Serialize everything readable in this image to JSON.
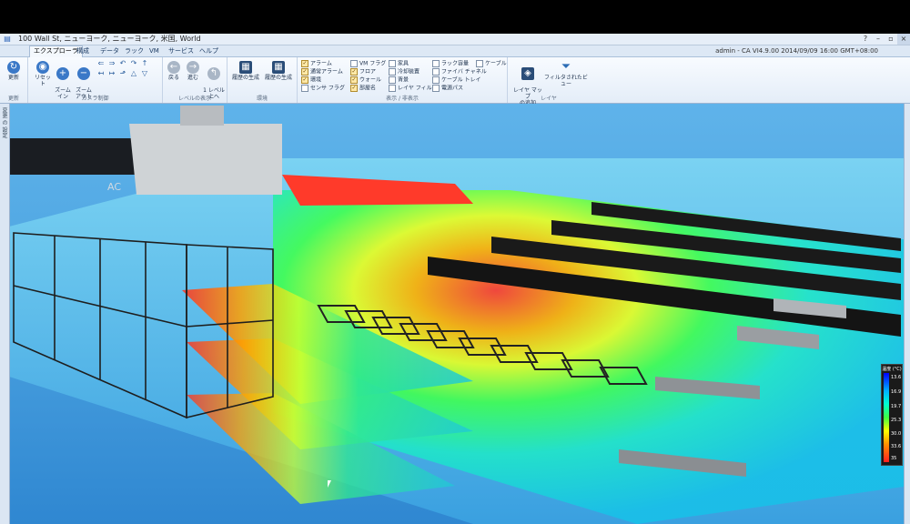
{
  "window": {
    "title": "100 Wall St, ニューヨーク, ニューヨーク, 米国, World",
    "controls": [
      "?",
      "–",
      "▫",
      "×"
    ]
  },
  "menu": {
    "tabs": [
      "エクスプローラ",
      "構成",
      "データ",
      "ラック",
      "VM",
      "サービス",
      "ヘルプ"
    ],
    "active_tab": "エクスプローラ",
    "user_info": "admin - CA VI4.9.00    2014/09/09 16:00 GMT+08:00"
  },
  "ribbon": {
    "groups": {
      "refresh": {
        "label": "更新",
        "button": "更新"
      },
      "camera": {
        "label": "カメラ制御",
        "reset": "リセット",
        "zoom_in": "ズーム\nイン",
        "zoom_out": "ズーム\nアウト"
      },
      "level": {
        "label": "レベルの表示",
        "back": "戻る",
        "forward": "進む",
        "up": "1 レベル\n上へ"
      },
      "report": {
        "label": "環境",
        "gen1": "履歴の生成",
        "gen2": "履歴の生成"
      },
      "display": {
        "label": "表示 / 非表示",
        "items": [
          {
            "text": "アラーム",
            "checked": true
          },
          {
            "text": "通常アラーム",
            "checked": true
          },
          {
            "text": "環境",
            "checked": true
          },
          {
            "text": "センサ フラグ",
            "checked": false
          },
          {
            "text": "VM フラグ",
            "checked": false
          },
          {
            "text": "フロア",
            "checked": true
          },
          {
            "text": "ウォール",
            "checked": true
          },
          {
            "text": "部屋名",
            "checked": true
          },
          {
            "text": "家具",
            "checked": false
          },
          {
            "text": "冷却装置",
            "checked": false
          },
          {
            "text": "背景",
            "checked": false
          },
          {
            "text": "レイヤ フィルタ",
            "checked": false
          },
          {
            "text": "ラック容量",
            "checked": false
          },
          {
            "text": "ファイバ チャネル",
            "checked": false
          },
          {
            "text": "ケーブル トレイ",
            "checked": false
          },
          {
            "text": "電源パス",
            "checked": false
          },
          {
            "text": "ケーブル",
            "checked": false
          }
        ]
      },
      "layer": {
        "label": "レイヤ",
        "add_map": "レイヤ マップ\nの追加",
        "filtered_view": "フィルタされたビュー"
      }
    }
  },
  "sidebar": {
    "left_label": "変更 の 設定"
  },
  "legend": {
    "title": "温度 (°C)",
    "ticks": [
      "13.6",
      "16.9",
      "19.7",
      "25.3",
      "30.0",
      "33.6",
      "35"
    ],
    "colors": {
      "cold": "#0000ff",
      "hot": "#ff2020"
    }
  },
  "scene": {
    "watermark": "AC"
  }
}
